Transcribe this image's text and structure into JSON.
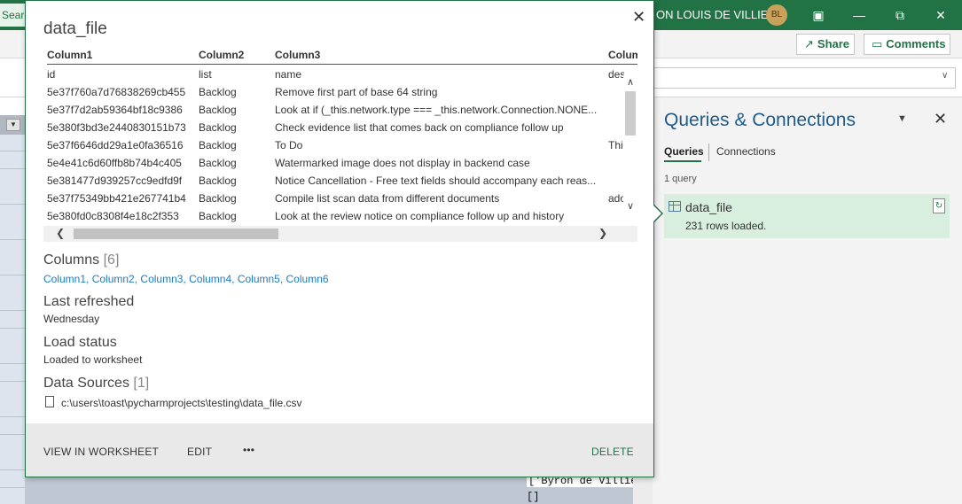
{
  "titlebar": {
    "search_stub": "Search",
    "user_name": "ON LOUIS DE VILLIERS",
    "user_initials": "BL",
    "share_label": "Share",
    "comments_label": "Comments"
  },
  "sheet": {
    "cell1": "['Byron de Villiers',",
    "cell2": "[]"
  },
  "queries_pane": {
    "title": "Queries & Connections",
    "tabs": [
      "Queries",
      "Connections"
    ],
    "count_text": "1 query",
    "query": {
      "name": "data_file",
      "status": "231 rows loaded."
    }
  },
  "popup": {
    "title": "data_file",
    "columns_header": [
      "Column1",
      "Column2",
      "Column3",
      "Colum"
    ],
    "rows": [
      [
        "id",
        "list",
        "name",
        "des"
      ],
      [
        "5e37f760a7d76838269cb455",
        "Backlog",
        "Remove first part of base 64 string",
        ""
      ],
      [
        "5e37f7d2ab59364bf18c9386",
        "Backlog",
        "Look at if (_this.network.type === _this.network.Connection.NONE...",
        ""
      ],
      [
        "5e380f3bd3e2440830151b73",
        "Backlog",
        "Check evidence list that comes back on compliance follow up",
        ""
      ],
      [
        "5e37f6646dd29a1e0fa36516",
        "Backlog",
        "To Do",
        "Thi"
      ],
      [
        "5e4e41c6d60ffb8b74b4c405",
        "Backlog",
        "Watermarked image does not display in backend case",
        ""
      ],
      [
        "5e381477d939257cc9edfd9f",
        "Backlog",
        "Notice Cancellation - Free text fields should accompany each reas...",
        ""
      ],
      [
        "5e37f75349bb421e267741b4",
        "Backlog",
        "Compile list scan data from different documents",
        "ado"
      ],
      [
        "5e380fd0c8308f4e18c2f353",
        "Backlog",
        "Look at the review notice on compliance follow up and history",
        ""
      ]
    ],
    "columns_label": "Columns",
    "columns_count": "[6]",
    "column_links": [
      "Column1,",
      "Column2,",
      "Column3,",
      "Column4,",
      "Column5,",
      "Column6"
    ],
    "last_refreshed_label": "Last refreshed",
    "last_refreshed_value": "Wednesday",
    "load_status_label": "Load status",
    "load_status_value": "Loaded to worksheet",
    "data_sources_label": "Data Sources",
    "data_sources_count": "[1]",
    "data_source_path": "c:\\users\\toast\\pycharmprojects\\testing\\data_file.csv",
    "footer": {
      "view_label": "VIEW IN WORKSHEET",
      "edit_label": "EDIT",
      "more_label": "•••",
      "delete_label": "DELETE"
    }
  },
  "colors": {
    "excel_green": "#217346",
    "link_blue": "#1b7ac2",
    "query_card": "#d8efe0"
  }
}
